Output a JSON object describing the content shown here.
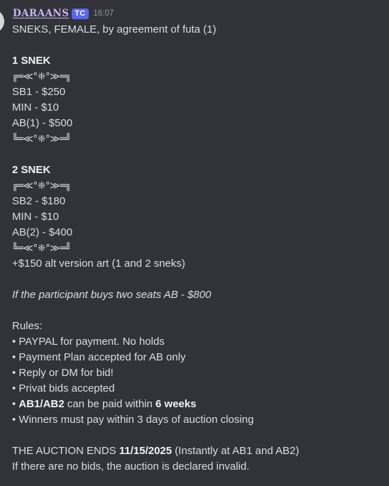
{
  "message": {
    "username": "DARAANS",
    "tag": "TC",
    "timestamp": "16:07",
    "lines": {
      "l1": "SNEKS, FEMALE, by agreement of futa (1)",
      "l3": "1 SNEK",
      "l4": "╔═≪°❈°≫═╗",
      "l5": "SB1 - $250",
      "l6": "MIN - $10",
      "l7": "AB(1) - $500",
      "l8": "╚═≪°❈°≫═╝",
      "l10": "2 SNEK",
      "l11": "╔═≪°❈°≫═╗",
      "l12": "SB2 - $180",
      "l13": "MIN - $10",
      "l14": "AB(2) - $400",
      "l15": "╚═≪°❈°≫═╝",
      "l16": "+$150 alt version art (1 and 2 sneks)",
      "l18": "If the participant buys two seats AB - $800",
      "l20": "Rules:",
      "l21": "• PAYPAL for payment. No holds",
      "l22": "• Payment Plan accepted for AB only",
      "l23": "• Reply or DM for bid!",
      "l24": "• Privat bids accepted",
      "l25a": "• ",
      "l25b": "AB1/AB2",
      "l25c": " can be paid within ",
      "l25d": "6 weeks",
      "l26": "• Winners must pay within 3 days of auction closing",
      "l28a": "THE AUCTION ENDS ",
      "l28b": "11/15/2025",
      "l28c": " (Instantly at AB1 and AB2)",
      "l29": "If there are no bids, the auction is declared invalid."
    }
  },
  "colors": {
    "background": "#313338",
    "username": "#c9b4f2",
    "tag_bg": "#5865f2",
    "text": "#dbdee1",
    "timestamp": "#949ba4"
  }
}
